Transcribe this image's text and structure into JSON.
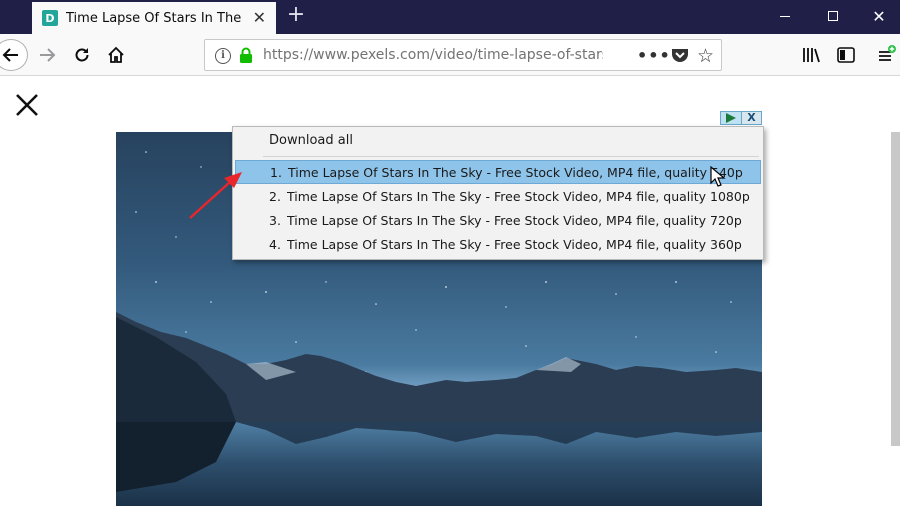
{
  "browser": {
    "tab": {
      "favicon_letter": "D",
      "title": "Time Lapse Of Stars In The Sky",
      "close_glyph": "✕"
    },
    "new_tab_glyph": "+",
    "url": "https://www.pexels.com/video/time-lapse-of-stars",
    "url_more_glyph": "•••",
    "bookmark_glyph": "☆",
    "window_close_glyph": "✕"
  },
  "overlay": {
    "close_glyph": "✕"
  },
  "ad": {
    "close_glyph": "X"
  },
  "download_menu": {
    "header": "Download all",
    "items": [
      {
        "num": "1.",
        "label": "Time Lapse Of Stars In The Sky - Free Stock Video,  MP4 file, quality 540p",
        "highlighted": true
      },
      {
        "num": "2.",
        "label": "Time Lapse Of Stars In The Sky - Free Stock Video,  MP4 file, quality 1080p",
        "highlighted": false
      },
      {
        "num": "3.",
        "label": "Time Lapse Of Stars In The Sky - Free Stock Video,  MP4 file, quality 720p",
        "highlighted": false
      },
      {
        "num": "4.",
        "label": "Time Lapse Of Stars In The Sky - Free Stock Video,  MP4 file, quality 360p",
        "highlighted": false
      }
    ]
  },
  "colors": {
    "titlebar": "#1f1f47",
    "highlight": "#8fc4ea",
    "lock_green": "#12bc00",
    "arrow_red": "#e8262b"
  },
  "icons": [
    "back-arrow-icon",
    "forward-arrow-icon",
    "reload-icon",
    "home-icon",
    "info-icon",
    "lock-icon",
    "more-icon",
    "pocket-icon",
    "star-icon",
    "library-icon",
    "sidebar-icon",
    "menu-icon"
  ]
}
